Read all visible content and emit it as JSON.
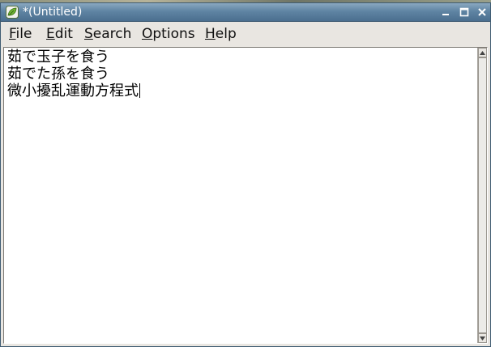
{
  "window": {
    "title": "*(Untitled)",
    "app_icon": "leaf-app-icon",
    "controls": {
      "minimize": "minimize-icon",
      "maximize": "maximize-icon",
      "close": "close-icon"
    }
  },
  "menubar": {
    "items": [
      {
        "label": "File",
        "mnemonic": "F",
        "rest": "ile"
      },
      {
        "label": "Edit",
        "mnemonic": "E",
        "rest": "dit"
      },
      {
        "label": "Search",
        "mnemonic": "S",
        "rest": "earch"
      },
      {
        "label": "Options",
        "mnemonic": "O",
        "rest": "ptions"
      },
      {
        "label": "Help",
        "mnemonic": "H",
        "rest": "elp"
      }
    ]
  },
  "editor": {
    "lines": [
      "茹で玉子を食う",
      "茹でた孫を食う",
      "微小擾乱運動方程式"
    ]
  },
  "colors": {
    "titlebar": "#5f84a3",
    "chrome": "#e9e6e1",
    "editor_bg": "#ffffff"
  }
}
